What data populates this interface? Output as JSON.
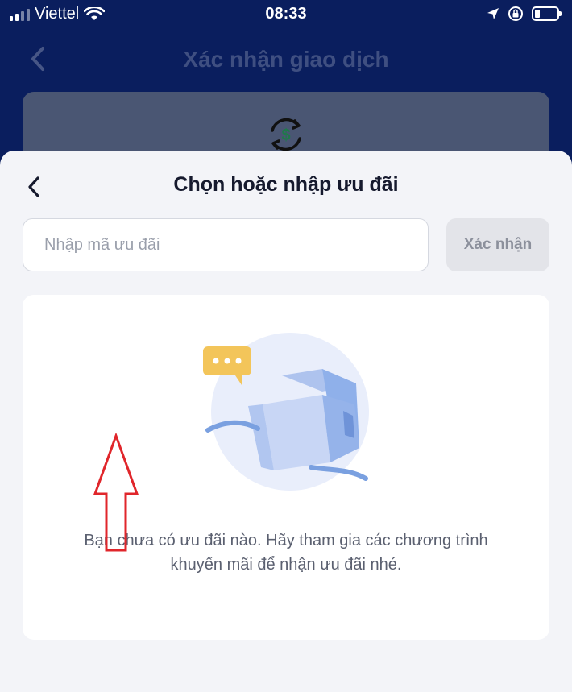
{
  "status_bar": {
    "carrier": "Viettel",
    "time": "08:33",
    "icons": [
      "signal-icon",
      "wifi-icon",
      "location-arrow-icon",
      "rotation-lock-icon",
      "battery-icon"
    ]
  },
  "background_screen": {
    "title": "Xác nhận giao dịch",
    "card_icon": "currency-exchange-icon"
  },
  "sheet": {
    "title": "Chọn hoặc nhập ưu đãi",
    "input": {
      "placeholder": "Nhập mã ưu đãi",
      "value": ""
    },
    "confirm_label": "Xác nhận",
    "empty_state": {
      "illustration": "empty-gift-box-illustration",
      "message": "Bạn chưa có ưu đãi nào. Hãy tham gia các chương trình khuyến mãi để nhận ưu đãi nhé."
    }
  },
  "colors": {
    "header_bg": "#0a1e5e",
    "sheet_bg": "#f3f4f8",
    "annotation_arrow": "#e0262b",
    "illustration_blue": "#7aa0e0",
    "chat_bubble": "#f3c55a"
  }
}
